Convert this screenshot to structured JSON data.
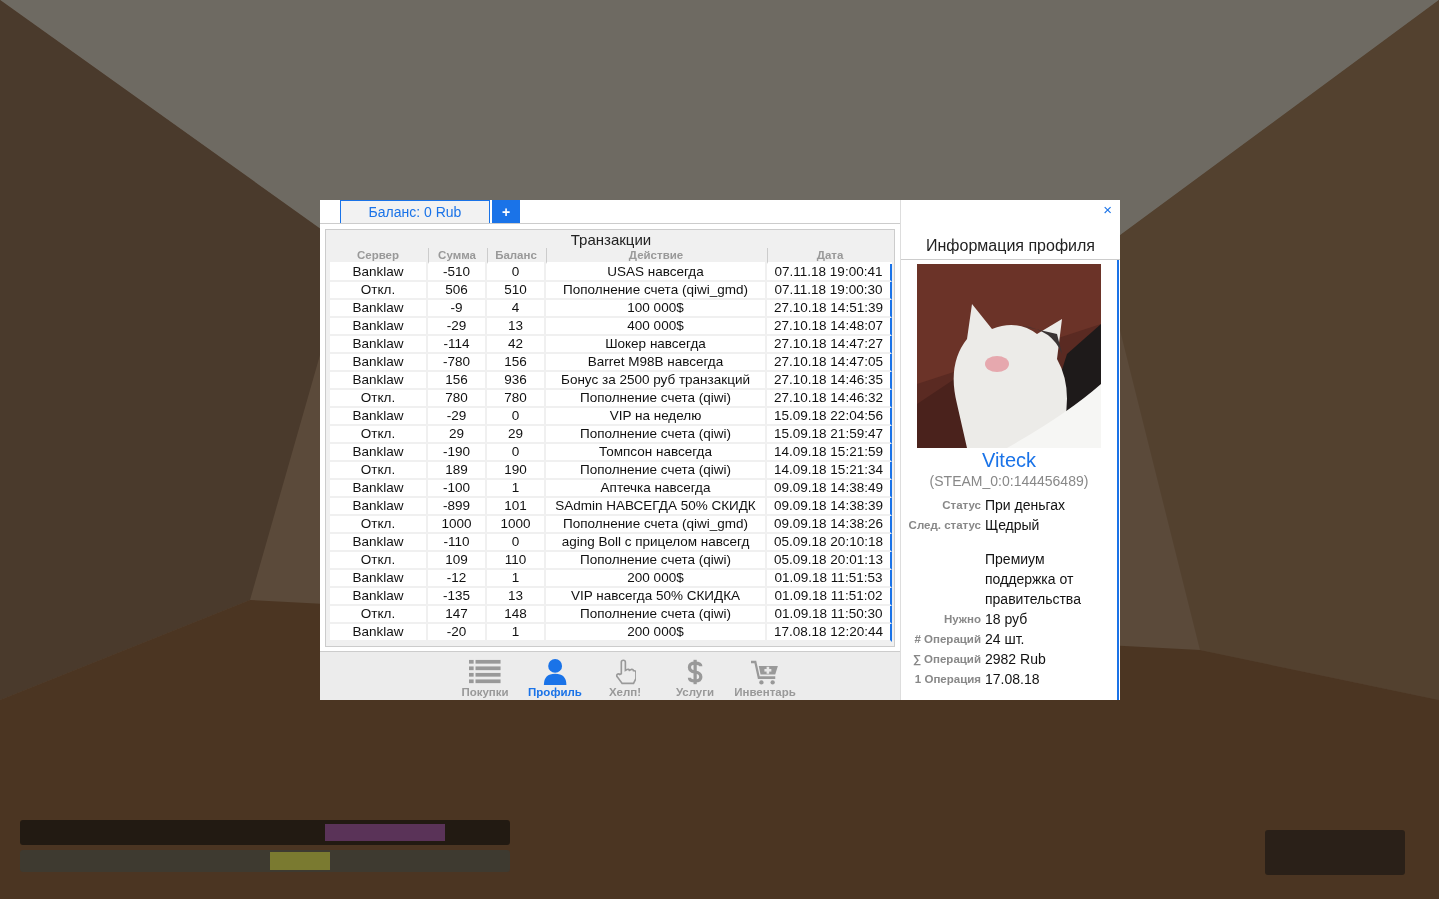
{
  "dialog": {
    "tabs": [
      {
        "label": "Баланс: 0 Rub",
        "kind": "text",
        "selected": true
      },
      {
        "label": "+",
        "kind": "add",
        "selected": false
      }
    ],
    "close": "×",
    "table": {
      "title": "Транзакции",
      "columns": [
        "Сервер",
        "Сумма",
        "Баланс",
        "Действие",
        "Дата"
      ],
      "rows": [
        [
          "Banklaw",
          "-510",
          "0",
          "USAS навсегда",
          "07.11.18 19:00:41"
        ],
        [
          "Откл.",
          "506",
          "510",
          "Пополнение счета (qiwi_gmd)",
          "07.11.18 19:00:30"
        ],
        [
          "Banklaw",
          "-9",
          "4",
          "100 000$",
          "27.10.18 14:51:39"
        ],
        [
          "Banklaw",
          "-29",
          "13",
          "400 000$",
          "27.10.18 14:48:07"
        ],
        [
          "Banklaw",
          "-114",
          "42",
          "Шокер навсегда",
          "27.10.18 14:47:27"
        ],
        [
          "Banklaw",
          "-780",
          "156",
          "Barret M98B навсегда",
          "27.10.18 14:47:05"
        ],
        [
          "Banklaw",
          "156",
          "936",
          "Бонус за 2500 руб транзакций",
          "27.10.18 14:46:35"
        ],
        [
          "Откл.",
          "780",
          "780",
          "Пополнение счета (qiwi)",
          "27.10.18 14:46:32"
        ],
        [
          "Banklaw",
          "-29",
          "0",
          "VIP на неделю",
          "15.09.18 22:04:56"
        ],
        [
          "Откл.",
          "29",
          "29",
          "Пополнение счета (qiwi)",
          "15.09.18 21:59:47"
        ],
        [
          "Banklaw",
          "-190",
          "0",
          "Томпсон навсегда",
          "14.09.18 15:21:59"
        ],
        [
          "Откл.",
          "189",
          "190",
          "Пополнение счета (qiwi)",
          "14.09.18 15:21:34"
        ],
        [
          "Banklaw",
          "-100",
          "1",
          "Аптечка навсегда",
          "09.09.18 14:38:49"
        ],
        [
          "Banklaw",
          "-899",
          "101",
          "SAdmin НАВСЕГДА 50% СКИДК",
          "09.09.18 14:38:39"
        ],
        [
          "Откл.",
          "1000",
          "1000",
          "Пополнение счета (qiwi_gmd)",
          "09.09.18 14:38:26"
        ],
        [
          "Banklaw",
          "-110",
          "0",
          "aging Boll с прицелом навсегд",
          "05.09.18 20:10:18"
        ],
        [
          "Откл.",
          "109",
          "110",
          "Пополнение счета (qiwi)",
          "05.09.18 20:01:13"
        ],
        [
          "Banklaw",
          "-12",
          "1",
          "200 000$",
          "01.09.18 11:51:53"
        ],
        [
          "Banklaw",
          "-135",
          "13",
          "VIP навсегда 50% СКИДКА",
          "01.09.18 11:51:02"
        ],
        [
          "Откл.",
          "147",
          "148",
          "Пополнение счета (qiwi)",
          "01.09.18 11:50:30"
        ],
        [
          "Banklaw",
          "-20",
          "1",
          "200 000$",
          "17.08.18 12:20:44"
        ]
      ]
    },
    "nav": [
      {
        "label": "Покупки",
        "kind": "list",
        "selected": false
      },
      {
        "label": "Профиль",
        "kind": "person",
        "selected": true
      },
      {
        "label": "Хелп!",
        "kind": "hand",
        "selected": false
      },
      {
        "label": "Услуги",
        "kind": "dollar",
        "selected": false
      },
      {
        "label": "Инвентарь",
        "kind": "cart",
        "selected": false
      }
    ],
    "profile": {
      "title": "Информация профиля",
      "name": "Viteck",
      "steam_id": "(STEAM_0:0:144456489)",
      "fields": [
        {
          "label": "Статус",
          "value": "При деньгах"
        },
        {
          "label": "След. статус",
          "value": "Щедрый"
        },
        {
          "value": "Премиум поддержка от правительства"
        },
        {
          "label": "Нужно",
          "value": "18 руб"
        },
        {
          "label": "# Операций",
          "value": "24 шт."
        },
        {
          "label": "∑ Операций",
          "value": "2982 Rub"
        },
        {
          "label": "1 Операция",
          "value": "17.08.18"
        }
      ]
    }
  }
}
